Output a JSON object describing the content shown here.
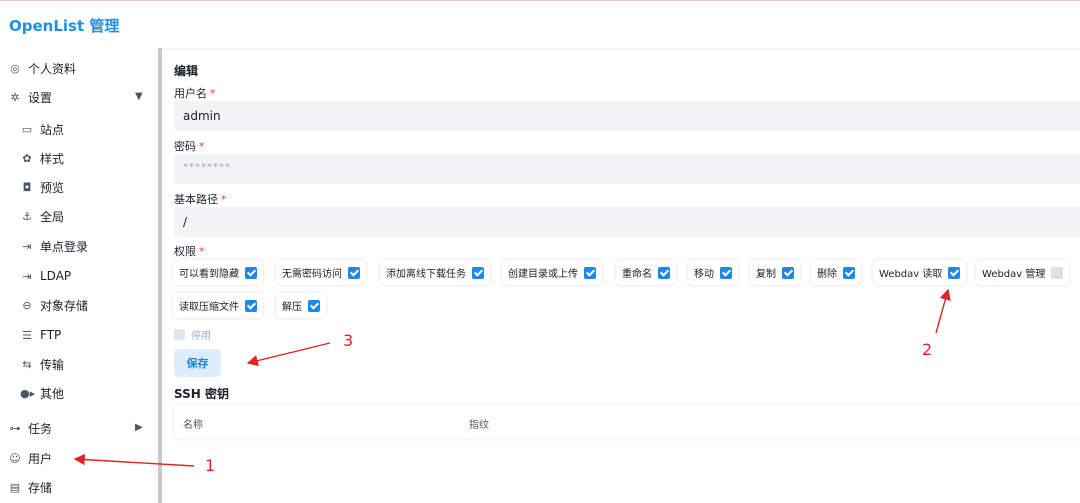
{
  "header": {
    "title": "OpenList 管理"
  },
  "sidebar": {
    "items": [
      {
        "label": "个人资料",
        "icon": "fingerprint-icon"
      },
      {
        "label": "设置",
        "icon": "gear-icon"
      },
      {
        "label": "站点",
        "icon": "window-icon"
      },
      {
        "label": "样式",
        "icon": "palette-icon"
      },
      {
        "label": "预览",
        "icon": "camera-icon"
      },
      {
        "label": "全局",
        "icon": "anchor-icon"
      },
      {
        "label": "单点登录",
        "icon": "login-icon"
      },
      {
        "label": "LDAP",
        "icon": "login-icon"
      },
      {
        "label": "对象存储",
        "icon": "bucket-icon"
      },
      {
        "label": "FTP",
        "icon": "server-icon"
      },
      {
        "label": "传输",
        "icon": "transfer-icon"
      },
      {
        "label": "其他",
        "icon": "dots-icon"
      },
      {
        "label": "任务",
        "icon": "task-icon"
      },
      {
        "label": "用户",
        "icon": "user-icon"
      },
      {
        "label": "存储",
        "icon": "storage-icon"
      }
    ]
  },
  "main": {
    "title": "编辑",
    "username": {
      "label": "用户名",
      "value": "admin"
    },
    "password": {
      "label": "密码",
      "placeholder": "********"
    },
    "base_path": {
      "label": "基本路径",
      "value": "/"
    },
    "permissions": {
      "label": "权限",
      "items": [
        {
          "label": "可以看到隐藏",
          "checked": true
        },
        {
          "label": "无需密码访问",
          "checked": true
        },
        {
          "label": "添加离线下载任务",
          "checked": true
        },
        {
          "label": "创建目录或上传",
          "checked": true
        },
        {
          "label": "重命名",
          "checked": true
        },
        {
          "label": "移动",
          "checked": true
        },
        {
          "label": "复制",
          "checked": true
        },
        {
          "label": "删除",
          "checked": true
        },
        {
          "label": "Webdav 读取",
          "checked": true
        },
        {
          "label": "Webdav 管理",
          "checked": false
        },
        {
          "label": "读取压缩文件",
          "checked": true
        },
        {
          "label": "解压",
          "checked": true
        }
      ]
    },
    "disable_label": "停用",
    "save_label": "保存",
    "ssh": {
      "title": "SSH 密钥",
      "columns": [
        "名称",
        "指纹"
      ]
    }
  },
  "annotations": [
    "1",
    "2",
    "3"
  ],
  "colors": {
    "accent": "#1e88e5",
    "brand": "#1f8fe5",
    "annotation": "#e02424",
    "required": "#e53e3e"
  }
}
